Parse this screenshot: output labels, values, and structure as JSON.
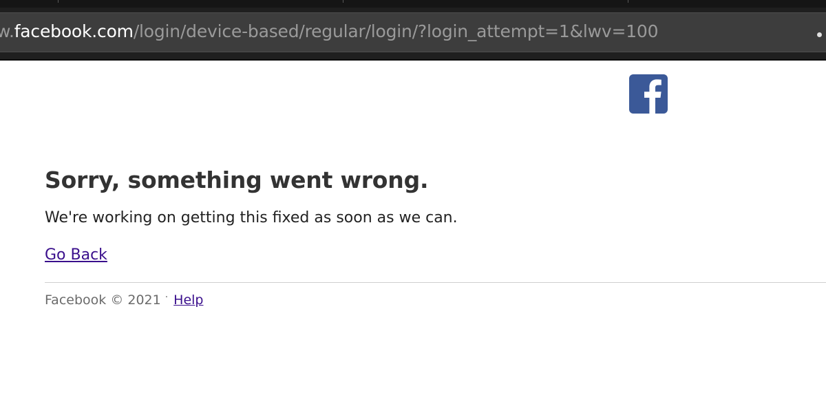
{
  "browser": {
    "url_prefix": "w.",
    "url_host": "facebook.com",
    "url_path": "/login/device-based/regular/login/?login_attempt=1&lwv=100"
  },
  "page": {
    "logo_icon": "facebook-f-icon",
    "brand_color": "#3b5998",
    "title": "Sorry, something went wrong.",
    "message": "We're working on getting this fixed as soon as we can.",
    "go_back_label": "Go Back",
    "link_color": "#3a0f8c"
  },
  "footer": {
    "copyright": "Facebook © 2021",
    "separator": "·",
    "help_label": "Help"
  }
}
